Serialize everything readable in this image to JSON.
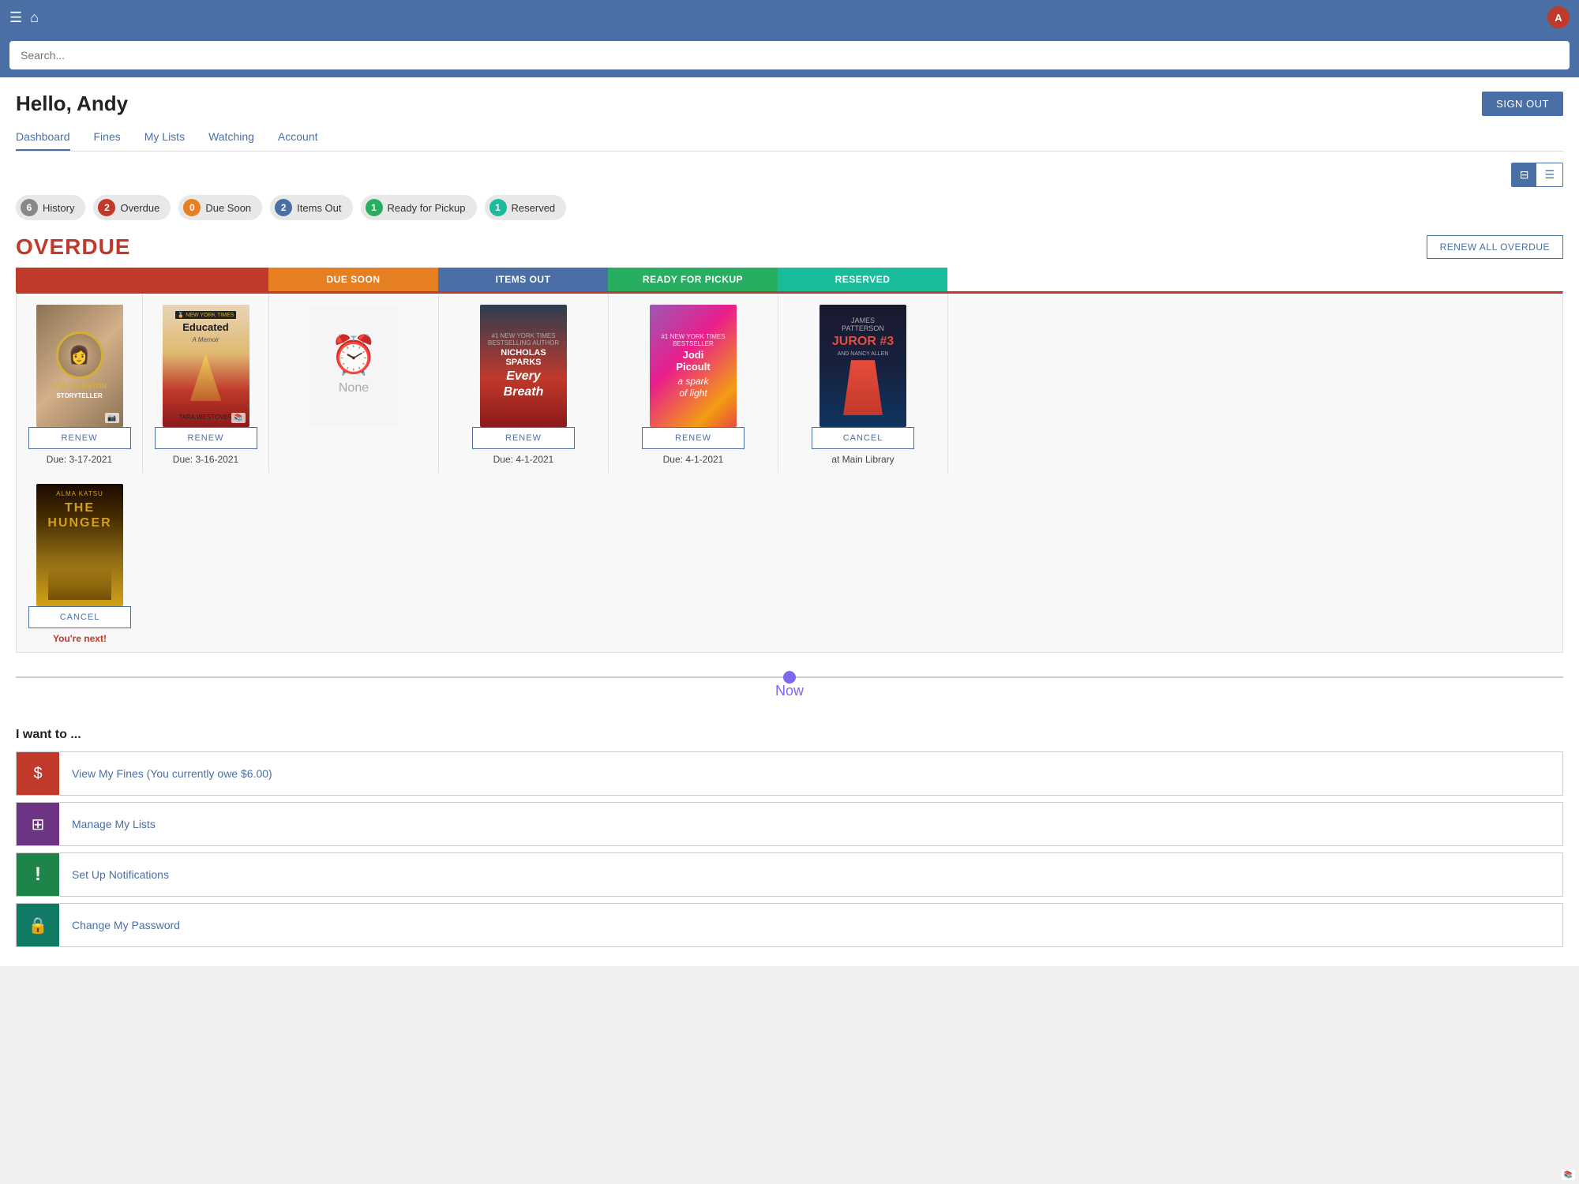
{
  "topbar": {
    "avatar_label": "A"
  },
  "search": {
    "placeholder": "Search..."
  },
  "header": {
    "greeting": "Hello, Andy",
    "sign_out": "SIGN OUT"
  },
  "tabs": [
    {
      "label": "Dashboard",
      "active": true
    },
    {
      "label": "Fines",
      "active": false
    },
    {
      "label": "My Lists",
      "active": false
    },
    {
      "label": "Watching",
      "active": false
    },
    {
      "label": "Account",
      "active": false
    }
  ],
  "pills": [
    {
      "count": 6,
      "label": "History",
      "color": "#888888"
    },
    {
      "count": 2,
      "label": "Overdue",
      "color": "#c0392b"
    },
    {
      "count": 0,
      "label": "Due Soon",
      "color": "#e67e22"
    },
    {
      "count": 2,
      "label": "Items Out",
      "color": "#4a6fa5"
    },
    {
      "count": 1,
      "label": "Ready for Pickup",
      "color": "#27ae60"
    },
    {
      "count": 1,
      "label": "Reserved",
      "color": "#1abc9c"
    }
  ],
  "overdue": {
    "title": "OVERDUE",
    "renew_all_label": "RENEW ALL OVERDUE"
  },
  "section_bars": [
    {
      "label": "",
      "type": "overdue"
    },
    {
      "label": "DUE SOON",
      "type": "due-soon"
    },
    {
      "label": "ITEMS OUT",
      "type": "items-out"
    },
    {
      "label": "READY FOR PICKUP",
      "type": "ready"
    },
    {
      "label": "RESERVED",
      "type": "reserved"
    }
  ],
  "books": [
    {
      "title": "Dolly Parton Storyteller",
      "type": "dolly",
      "action": "RENEW",
      "due": "Due: 3-17-2021"
    },
    {
      "title": "Educated",
      "author": "Tara Westover",
      "type": "educated",
      "action": "RENEW",
      "due": "Due: 3-16-2021"
    },
    {
      "title": "None",
      "type": "none",
      "action": "",
      "due": ""
    },
    {
      "title": "Every Breath",
      "author": "Nicholas Sparks",
      "type": "every-breath",
      "action": "RENEW",
      "due": "Due: 4-1-2021"
    },
    {
      "title": "A Spark of Light",
      "author": "Jodi Picoult",
      "type": "spark",
      "action": "RENEW",
      "due": "Due: 4-1-2021"
    },
    {
      "title": "Juror #3",
      "author": "James Patterson",
      "type": "juror",
      "action": "CANCEL",
      "due": "at Main Library"
    },
    {
      "title": "The Hunger",
      "author": "Alma Katsu",
      "type": "hunger",
      "action": "CANCEL",
      "due": "You're next!"
    }
  ],
  "timeline": {
    "now_label": "Now"
  },
  "i_want": {
    "title": "I want to ...",
    "items": [
      {
        "label": "View My Fines (You currently owe $6.00)",
        "icon": "$",
        "color": "icon-red"
      },
      {
        "label": "Manage My Lists",
        "icon": "⊞",
        "color": "icon-purple"
      },
      {
        "label": "Set Up Notifications",
        "icon": "!",
        "color": "icon-darkgreen"
      },
      {
        "label": "Change My Password",
        "icon": "🔒",
        "color": "icon-teal"
      }
    ]
  }
}
